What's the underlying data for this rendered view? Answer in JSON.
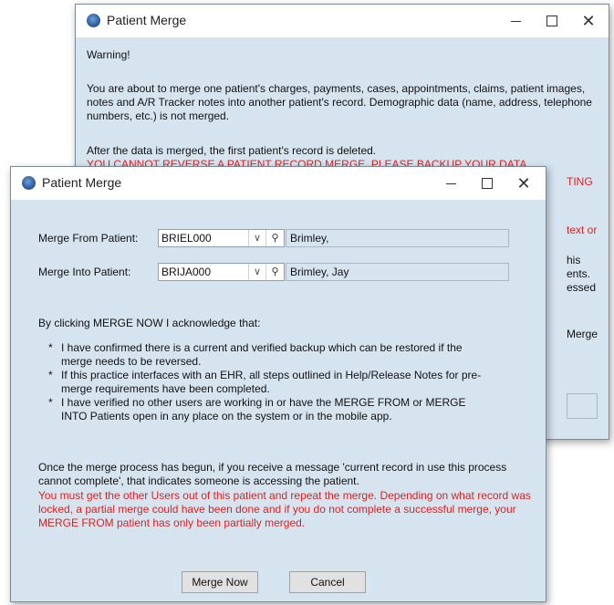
{
  "back_window": {
    "title": "Patient Merge",
    "warning_heading": "Warning!",
    "warning_para": "You are about to merge one patient's charges, payments, cases, appointments, claims, patient images, notes and A/R Tracker notes into another patient's record.  Demographic data (name, address, telephone numbers, etc.) is not merged.",
    "deleted_line": "After the data is merged, the first patient's record is deleted.",
    "red_line": "YOU CANNOT REVERSE A PATIENT RECORD MERGE.  PLEASE BACKUP YOUR DATA",
    "frag_1": "TING",
    "frag_2": "text or",
    "frag_3": "his",
    "frag_4": "ents.",
    "frag_5": "essed",
    "frag_6": "Merge"
  },
  "front_window": {
    "title": "Patient Merge",
    "merge_from_label": "Merge From Patient:",
    "merge_from_code": "BRIEL000",
    "merge_from_name": "Brimley,",
    "merge_into_label": "Merge Into Patient:",
    "merge_into_code": "BRIJA000",
    "merge_into_name": "Brimley, Jay",
    "ack_intro": "By clicking MERGE NOW I acknowledge that:",
    "bullets": [
      "I have confirmed there is a current and verified backup which can be restored if the merge needs to be reversed.",
      "If this practice interfaces with an EHR, all steps outlined in Help/Release Notes for pre-merge requirements have been completed.",
      "I have verified no other users are working in or have the MERGE FROM or MERGE INTO Patients open in any place on the system or in the mobile app."
    ],
    "process_note": "Once the merge process has begun, if you receive a message 'current record in use this process cannot complete', that indicates someone is accessing the patient.",
    "red_note": "You must get the other Users out of this patient and repeat the merge.  Depending on what record was locked, a partial merge could have been done and if you do not complete a successful merge, your MERGE FROM patient has only been partially merged.",
    "merge_now_label": "Merge Now",
    "cancel_label": "Cancel"
  }
}
